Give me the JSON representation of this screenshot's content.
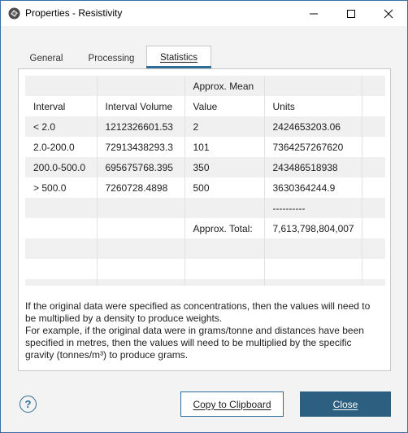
{
  "window": {
    "title": "Properties - Resistivity",
    "icon": "app-logo-icon"
  },
  "tabs": [
    {
      "label": "General",
      "active": false
    },
    {
      "label": "Processing",
      "active": false
    },
    {
      "label": "Statistics",
      "active": true
    }
  ],
  "table": {
    "rows": [
      [
        "",
        "",
        "Approx. Mean",
        "",
        ""
      ],
      [
        "Interval",
        "Interval Volume",
        "Value",
        "Units",
        ""
      ],
      [
        "< 2.0",
        "1212326601.53",
        "2",
        "2424653203.06",
        ""
      ],
      [
        "2.0-200.0",
        "72913438293.3",
        "101",
        "7364257267620",
        ""
      ],
      [
        "200.0-500.0",
        "695675768.395",
        "350",
        "243486518938",
        ""
      ],
      [
        "> 500.0",
        "7260728.4898",
        "500",
        "3630364244.9",
        ""
      ],
      [
        "",
        "",
        "",
        "----------",
        ""
      ],
      [
        "",
        "",
        "Approx. Total:",
        "7,613,798,804,007",
        ""
      ],
      [
        "",
        "",
        "",
        "",
        ""
      ],
      [
        "",
        "",
        "",
        "",
        ""
      ],
      [
        "",
        "",
        "",
        "",
        ""
      ]
    ]
  },
  "note": {
    "line1": "If the original data were specified as concentrations, then the values will need to be multiplied by a density to produce weights.",
    "line2": "For example, if the original data were in grams/tonne and distances have been specified in metres, then the values will need to be multiplied by the specific gravity (tonnes/m³) to produce grams."
  },
  "buttons": {
    "help": "?",
    "copy": "Copy to Clipboard",
    "close": "Close"
  },
  "colors": {
    "accent": "#2e6d95",
    "primary_button": "#2c5f80",
    "row_alt": "#f0f0f0"
  }
}
